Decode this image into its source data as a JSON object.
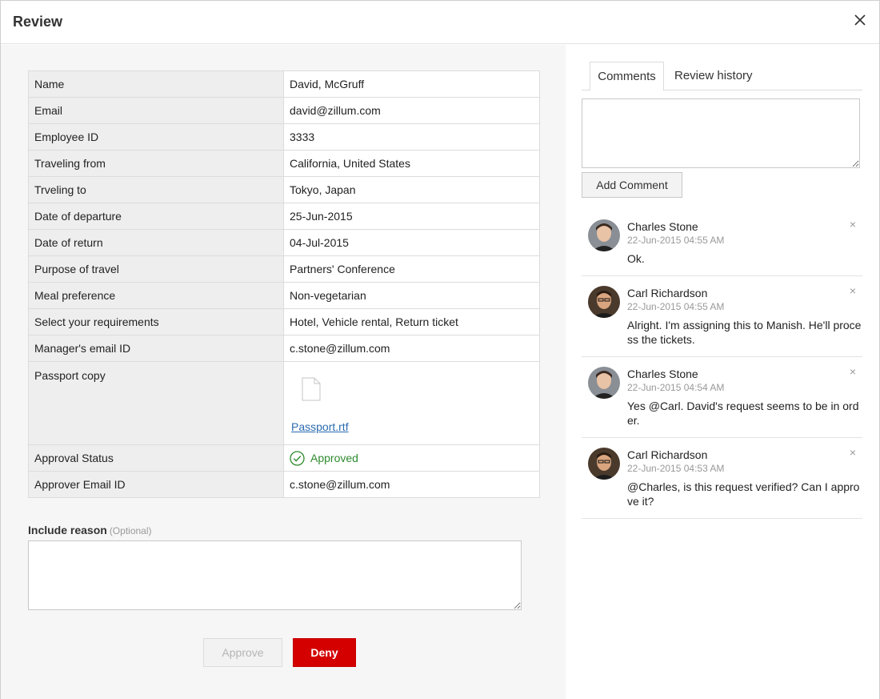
{
  "header": {
    "title": "Review"
  },
  "details": [
    {
      "label": "Name",
      "value": "David, McGruff"
    },
    {
      "label": "Email",
      "value": "david@zillum.com"
    },
    {
      "label": "Employee ID",
      "value": "3333"
    },
    {
      "label": "Traveling from",
      "value": "California, United States"
    },
    {
      "label": "Trveling to",
      "value": "Tokyo, Japan"
    },
    {
      "label": "Date of departure",
      "value": "25-Jun-2015"
    },
    {
      "label": "Date of return",
      "value": "04-Jul-2015"
    },
    {
      "label": "Purpose of travel",
      "value": "Partners' Conference"
    },
    {
      "label": "Meal preference",
      "value": "Non-vegetarian"
    },
    {
      "label": "Select your requirements",
      "value": "Hotel, Vehicle rental, Return ticket"
    },
    {
      "label": "Manager's email ID",
      "value": "c.stone@zillum.com"
    }
  ],
  "passport": {
    "label": "Passport copy",
    "file": "Passport.rtf"
  },
  "approval": {
    "label": "Approval Status",
    "value": "Approved",
    "color": "#2e8b2e"
  },
  "approver": {
    "label": "Approver Email ID",
    "value": "c.stone@zillum.com"
  },
  "reason": {
    "label": "Include reason",
    "optional": "(Optional)"
  },
  "actions": {
    "approve_label": "Approve",
    "deny_label": "Deny",
    "deny_color": "#d40000"
  },
  "tabs": [
    {
      "label": "Comments",
      "active": true
    },
    {
      "label": "Review history",
      "active": false
    }
  ],
  "comment_form": {
    "add_label": "Add Comment"
  },
  "comments": [
    {
      "name": "Charles Stone",
      "time": "22-Jun-2015 04:55 AM",
      "text": "Ok.",
      "delete": "×"
    },
    {
      "name": "Carl Richardson",
      "time": "22-Jun-2015 04:55 AM",
      "text": "Alright. I'm assigning this to Manish. He'll process the tickets.",
      "delete": "×"
    },
    {
      "name": "Charles Stone",
      "time": "22-Jun-2015 04:54 AM",
      "text": "Yes @Carl. David's request seems to be in order.",
      "delete": "×"
    },
    {
      "name": "Carl Richardson",
      "time": "22-Jun-2015 04:53 AM",
      "text": "@Charles, is this request verified? Can I approve it?",
      "delete": "×"
    }
  ]
}
